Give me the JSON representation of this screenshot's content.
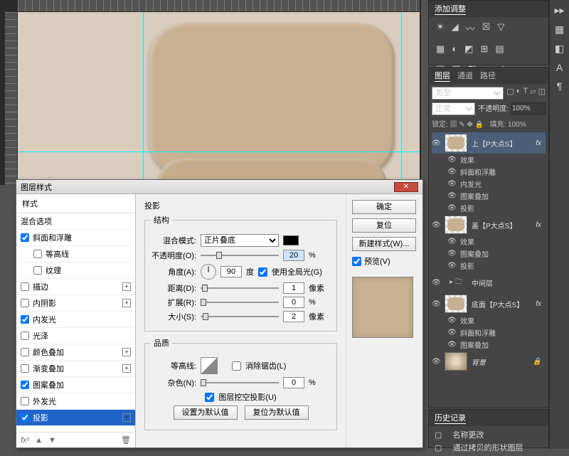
{
  "adjust": {
    "title": "添加调整"
  },
  "layers_panel": {
    "tabs": [
      "图层",
      "通道",
      "路径"
    ],
    "kind_label": "类型",
    "mode": "正常",
    "opacity_label": "不透明度:",
    "opacity_value": "100%",
    "lock_label": "锁定:",
    "fill_label": "填充:",
    "fill_value": "100%",
    "fx_label": "fx",
    "effects_label": "效果",
    "layers": [
      {
        "name": "上【P大点S】",
        "effects": [
          "斜面和浮雕",
          "内发光",
          "图案叠加",
          "投影"
        ]
      },
      {
        "name": "盖【P大点S】",
        "effects": [
          "图案叠加",
          "投影"
        ]
      },
      {
        "name": "中间层",
        "folder": true
      },
      {
        "name": "底面【P大点S】",
        "effects": [
          "斜面和浮雕",
          "图案叠加"
        ]
      },
      {
        "name": "背景",
        "bg": true
      }
    ]
  },
  "history": {
    "title": "历史记录",
    "items": [
      "名称更改",
      "通过拷贝的形状图层"
    ]
  },
  "dialog": {
    "title": "图层样式",
    "ok": "确定",
    "cancel": "复位",
    "newstyle": "新建样式(W)...",
    "preview": "预览(V)",
    "styles_head": "样式",
    "blend_opts": "混合选项",
    "list": [
      {
        "label": "斜面和浮雕",
        "checked": true
      },
      {
        "label": "等高线",
        "checked": false,
        "indent": true
      },
      {
        "label": "纹理",
        "checked": false,
        "indent": true
      },
      {
        "label": "描边",
        "checked": false,
        "add": true
      },
      {
        "label": "内阴影",
        "checked": false,
        "add": true
      },
      {
        "label": "内发光",
        "checked": true
      },
      {
        "label": "光泽",
        "checked": false
      },
      {
        "label": "颜色叠加",
        "checked": false,
        "add": true
      },
      {
        "label": "渐变叠加",
        "checked": false,
        "add": true
      },
      {
        "label": "图案叠加",
        "checked": true
      },
      {
        "label": "外发光",
        "checked": false
      },
      {
        "label": "投影",
        "checked": true,
        "add": true,
        "selected": true
      }
    ],
    "section": "投影",
    "group_structure": "结构",
    "blend_mode_label": "混合模式:",
    "blend_mode_value": "正片叠底",
    "opacity_label": "不透明度(O):",
    "opacity_value": "20",
    "opacity_unit": "%",
    "angle_label": "角度(A):",
    "angle_value": "90",
    "angle_unit": "度",
    "global_light": "使用全局光(G)",
    "distance_label": "距离(D):",
    "distance_value": "1",
    "px": "像素",
    "spread_label": "扩展(R):",
    "spread_value": "0",
    "spread_unit": "%",
    "size_label": "大小(S):",
    "size_value": "2",
    "group_quality": "品质",
    "contour_label": "等高线:",
    "antialias": "消除锯齿(L)",
    "noise_label": "杂色(N):",
    "noise_value": "0",
    "noise_unit": "%",
    "knockout": "图层挖空投影(U)",
    "make_default": "设置为默认值",
    "reset_default": "复位为默认值"
  }
}
